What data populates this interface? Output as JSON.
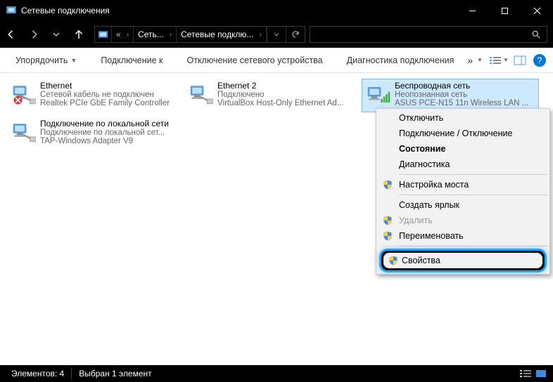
{
  "window": {
    "title": "Сетевые подключения"
  },
  "breadcrumbs": {
    "items": [
      "Сеть...",
      "Сетевые подклю..."
    ]
  },
  "search": {
    "placeholder": ""
  },
  "toolbar": {
    "organize": "Упорядочить",
    "connect": "Подключение к",
    "disable": "Отключение сетевого устройства",
    "diagnose": "Диагностика подключения",
    "overflow": "»"
  },
  "adapters": [
    {
      "name": "Ethernet",
      "status": "Сетевой кабель не подключен",
      "device": "Realtek PCIe GbE Family Controller",
      "icon": "ethernet-disconnected",
      "selected": false
    },
    {
      "name": "Ethernet 2",
      "status": "Подключено",
      "device": "VirtualBox Host-Only Ethernet Ad...",
      "icon": "ethernet",
      "selected": false
    },
    {
      "name": "Беспроводная сеть",
      "status": "Неопознанная сеть",
      "device": "ASUS PCE-N15 11n Wireless LAN ...",
      "icon": "wifi",
      "selected": true
    },
    {
      "name": "Подключение по локальной сети",
      "status": "Подключение по локальной сет...",
      "device": "TAP-Windows Adapter V9",
      "icon": "ethernet",
      "selected": false
    }
  ],
  "context_menu": {
    "items": [
      {
        "label": "Отключить",
        "shield": false,
        "disabled": false,
        "bold": false
      },
      {
        "label": "Подключение / Отключение",
        "shield": false,
        "disabled": false,
        "bold": false
      },
      {
        "label": "Состояние",
        "shield": false,
        "disabled": false,
        "bold": true
      },
      {
        "label": "Диагностика",
        "shield": false,
        "disabled": false,
        "bold": false
      },
      {
        "sep": true
      },
      {
        "label": "Настройка моста",
        "shield": true,
        "disabled": false,
        "bold": false
      },
      {
        "sep": true
      },
      {
        "label": "Создать ярлык",
        "shield": false,
        "disabled": false,
        "bold": false
      },
      {
        "label": "Удалить",
        "shield": true,
        "disabled": true,
        "bold": false
      },
      {
        "label": "Переименовать",
        "shield": true,
        "disabled": false,
        "bold": false
      },
      {
        "sep": true
      },
      {
        "label": "Свойства",
        "shield": true,
        "disabled": false,
        "bold": false,
        "highlight": true
      }
    ]
  },
  "statusbar": {
    "count": "Элементов: 4",
    "selection": "Выбран 1 элемент"
  }
}
